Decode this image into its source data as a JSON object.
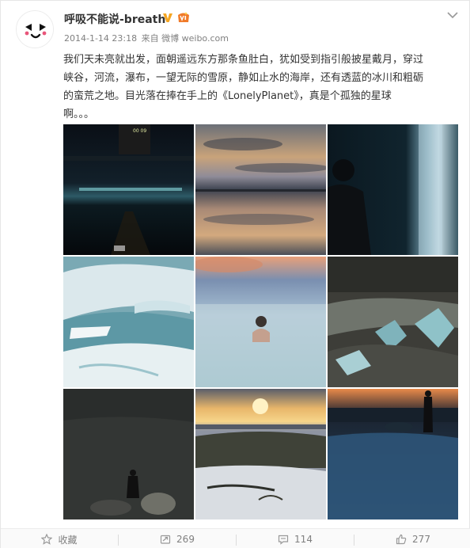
{
  "post": {
    "username": "呼吸不能说-breath",
    "date": "2014-1-14 23:18",
    "source": "来自 微博 weibo.com",
    "text_lines": [
      "我们天未亮就出发，面朝遥远东方那条鱼肚白，犹如受到指引般披星戴月，穿过",
      "峡谷，河流，瀑布，一望无际的雪原，静如止水的海岸，还有透蓝的冰川和粗砺",
      "的蛮荒之地。目光落在捧在手上的《LonelyPlanet》，真是个孤独的星球",
      "啊。。。"
    ],
    "photos": [
      {
        "label": "night-road-photo",
        "overlay_text": "00 09"
      },
      {
        "label": "sunset-reflection-photo"
      },
      {
        "label": "waterfall-portrait-photo"
      },
      {
        "label": "glacier-ice-photo"
      },
      {
        "label": "hot-spring-photo"
      },
      {
        "label": "black-ice-photo"
      },
      {
        "label": "dark-shore-photo"
      },
      {
        "label": "sunset-snow-field-photo"
      },
      {
        "label": "frozen-shore-silhouette-photo"
      }
    ]
  },
  "actions": {
    "favorite_label": "收藏",
    "repost_count": "269",
    "comment_count": "114",
    "like_count": "277"
  },
  "icons": {
    "verified": "verified-v-icon",
    "vip": "vip-badge-icon",
    "menu": "chevron-down-icon",
    "favorite": "star-icon",
    "repost": "repost-icon",
    "comment": "comment-icon",
    "like": "thumbs-up-icon"
  },
  "colors": {
    "verified": "#f5a623",
    "vip": "#f07b2a",
    "meta_text": "#808080"
  }
}
